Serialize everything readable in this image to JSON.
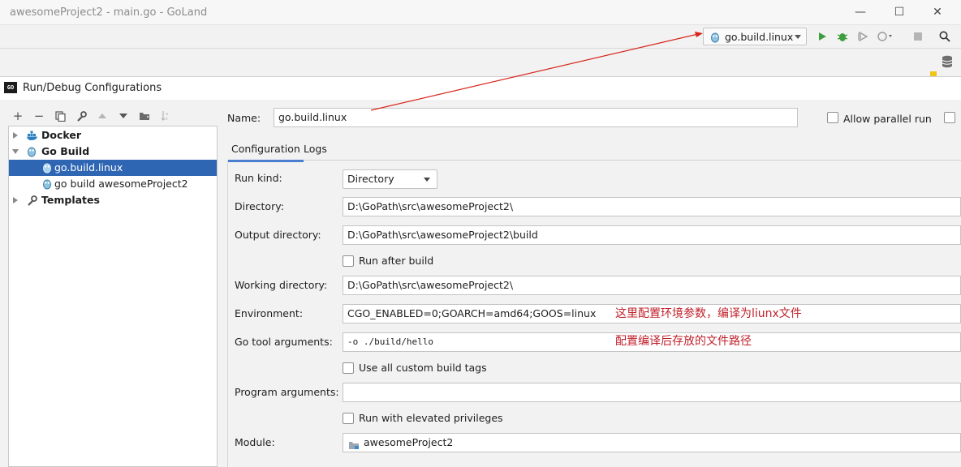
{
  "window": {
    "title": "awesomeProject2 - main.go - GoLand",
    "minimize": "—",
    "maximize": "☐",
    "close": "✕"
  },
  "toolbar": {
    "run_config": "go.build.linux",
    "icons": [
      "run-icon",
      "debug-icon",
      "coverage-icon",
      "profile-icon",
      "stop-icon",
      "search-icon"
    ],
    "colors": {
      "run": "#3e9e3e",
      "debug": "#3e9e3e"
    }
  },
  "dialog": {
    "title": "Run/Debug Configurations",
    "logo": "GO",
    "tools": [
      "add-icon",
      "remove-icon",
      "copy-icon",
      "wrench-icon",
      "move-up-icon",
      "move-down-icon",
      "folder-icon",
      "sort-icon"
    ],
    "tree": [
      {
        "label": "Docker",
        "bold": true,
        "expanded": false
      },
      {
        "label": "Go Build",
        "bold": true,
        "expanded": true
      },
      {
        "label": "go.build.linux",
        "selected": true
      },
      {
        "label": "go build awesomeProject2"
      },
      {
        "label": "Templates",
        "bold": true,
        "expanded": false
      }
    ],
    "name_label": "Name:",
    "name_value": "go.build.linux",
    "allow_parallel": "Allow parallel run",
    "tabs": [
      "Configuration",
      "Logs"
    ],
    "form": {
      "run_kind_label": "Run kind:",
      "run_kind_value": "Directory",
      "directory_label": "Directory:",
      "directory_value": "D:\\GoPath\\src\\awesomeProject2\\",
      "output_label": "Output directory:",
      "output_value": "D:\\GoPath\\src\\awesomeProject2\\build",
      "run_after_build": "Run after build",
      "working_label": "Working directory:",
      "working_value": "D:\\GoPath\\src\\awesomeProject2\\",
      "env_label": "Environment:",
      "env_value": "CGO_ENABLED=0;GOARCH=amd64;GOOS=linux",
      "tool_args_label": "Go tool arguments:",
      "tool_args_value": "-o ./build/hello",
      "custom_tags": "Use all custom build tags",
      "program_args_label": "Program arguments:",
      "program_args_value": "",
      "elevated": "Run with elevated privileges",
      "module_label": "Module:",
      "module_value": "awesomeProject2"
    },
    "notes": {
      "env": "这里配置环境参数，编译为liunx文件",
      "output": "配置编译后存放的文件路径"
    },
    "annotation_color": "#d9261c"
  }
}
